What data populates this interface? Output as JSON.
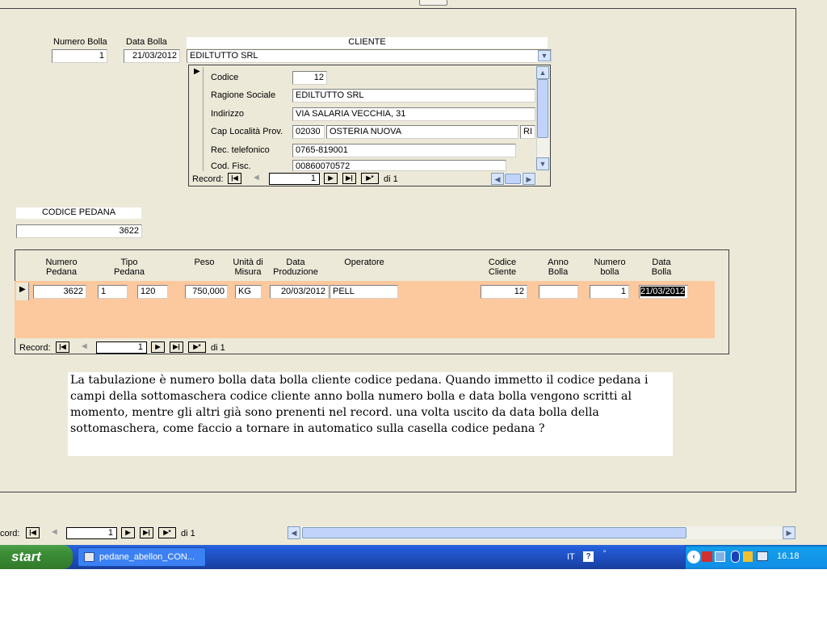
{
  "header": {
    "numero_bolla_label": "Numero Bolla",
    "data_bolla_label": "Data Bolla",
    "cliente_label": "CLIENTE",
    "numero_bolla_value": "1",
    "data_bolla_value": "21/03/2012",
    "cliente_value": "EDILTUTTO SRL"
  },
  "cliente_detail": {
    "codice_label": "Codice",
    "codice_value": "12",
    "ragione_sociale_label": "Ragione Sociale",
    "ragione_sociale_value": "EDILTUTTO SRL",
    "indirizzo_label": "Indirizzo",
    "indirizzo_value": "VIA SALARIA VECCHIA, 31",
    "cap_label": "Cap Località Prov.",
    "cap_value": "02030",
    "localita_value": "OSTERIA NUOVA",
    "prov_value": "RI",
    "telefono_label": "Rec. telefonico",
    "telefono_value": "0765-819001",
    "codfisc_label": "Cod. Fisc.",
    "codfisc_value": "00860070572",
    "nav": {
      "record_label": "Record:",
      "current": "1",
      "total": "di 1"
    }
  },
  "codice_pedana": {
    "label": "CODICE PEDANA",
    "value": "3622"
  },
  "subform": {
    "columns": [
      "Numero\nPedana",
      "Tipo\nPedana",
      "Peso",
      "Unità di\nMisura",
      "Data\nProduzione",
      "Operatore",
      "Codice\nCliente",
      "Anno\nBolla",
      "Numero\nbolla",
      "Data\nBolla"
    ],
    "row": {
      "numero_pedana": "3622",
      "tipo_pedana_1": "1",
      "tipo_pedana_2": "120",
      "peso": "750,000",
      "unita_misura": "KG",
      "data_produzione": "20/03/2012",
      "operatore": "PELL",
      "codice_cliente": "12",
      "anno_bolla": "",
      "numero_bolla": "1",
      "data_bolla": "21/03/2012"
    },
    "nav": {
      "record_label": "Record:",
      "current": "1",
      "total": "di 1"
    }
  },
  "note_text": "La tabulazione è numero bolla data bolla cliente codice pedana. Quando immetto il codice pedana i campi della sottomaschera codice cliente anno bolla numero bolla e data bolla vengono scritti al momento, mentre gli altri già sono prenenti nel record. una volta uscito da data bolla della sottomaschera, come faccio a tornare in automatico sulla casella codice pedana ?",
  "main_nav": {
    "record_label": "cord:",
    "current": "1",
    "total": "di 1"
  },
  "taskbar": {
    "start_label": "start",
    "app_label": "pedane_abellon_CON...",
    "language": "IT",
    "clock": "16.18"
  },
  "colors": {
    "form_bg": "#ece9d8",
    "subform_row": "#fcc89e",
    "taskbar_blue": "#245edb",
    "start_green": "#3c8f37"
  }
}
